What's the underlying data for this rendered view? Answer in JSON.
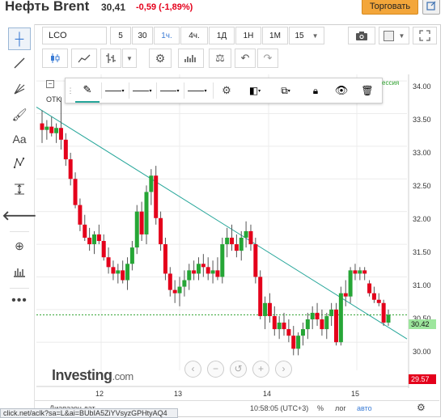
{
  "header": {
    "title": "Нефть Brent",
    "price": "30,41",
    "change": "-0,59 (-1,89%)",
    "trade_button": "Торговать"
  },
  "toolbar": {
    "symbol": "LCO",
    "intervals": [
      "5",
      "30",
      "1ч.",
      "4ч.",
      "1Д",
      "1Н",
      "1М",
      "15"
    ],
    "active_interval": "1ч."
  },
  "drawing_toolbar": {
    "items": [
      "pencil-icon",
      "line-style",
      "line-style",
      "line-style",
      "line-style",
      "gear-icon",
      "fill-icon",
      "copy-icon",
      "lock-icon",
      "eye-icon",
      "trash-icon"
    ]
  },
  "chart": {
    "session_label": "ессия",
    "legend_top": "",
    "legend_bottom": "OTK",
    "current_price_tag": "30.42",
    "low_price_tag": "29.57",
    "y_ticks": [
      "34.00",
      "33.50",
      "33.00",
      "32.50",
      "32.00",
      "31.50",
      "31.00",
      "30.50",
      "30.00"
    ],
    "x_ticks": [
      "12",
      "13",
      "14",
      "15"
    ]
  },
  "chart_data": {
    "type": "candlestick",
    "symbol": "LCO",
    "ylim": [
      29.57,
      34.1
    ],
    "y_ticks": [
      30.0,
      30.5,
      31.0,
      31.5,
      32.0,
      32.5,
      33.0,
      33.5,
      34.0
    ],
    "x_ticks": [
      "12",
      "13",
      "14",
      "15"
    ],
    "current_price": 30.42,
    "trendline": {
      "from": [
        0,
        33.6
      ],
      "to": [
        1,
        30.05
      ]
    },
    "candles": [
      {
        "o": 33.35,
        "h": 33.55,
        "l": 33.05,
        "c": 33.25
      },
      {
        "o": 33.25,
        "h": 33.4,
        "l": 33.1,
        "c": 33.3
      },
      {
        "o": 33.3,
        "h": 33.45,
        "l": 33.15,
        "c": 33.2
      },
      {
        "o": 33.2,
        "h": 33.35,
        "l": 33.05,
        "c": 33.28
      },
      {
        "o": 33.28,
        "h": 33.75,
        "l": 32.95,
        "c": 33.1
      },
      {
        "o": 33.1,
        "h": 33.2,
        "l": 32.7,
        "c": 32.8
      },
      {
        "o": 32.8,
        "h": 32.9,
        "l": 32.4,
        "c": 32.5
      },
      {
        "o": 32.5,
        "h": 32.6,
        "l": 32.05,
        "c": 32.1
      },
      {
        "o": 32.1,
        "h": 32.2,
        "l": 31.7,
        "c": 31.8
      },
      {
        "o": 31.8,
        "h": 31.95,
        "l": 31.55,
        "c": 31.6
      },
      {
        "o": 31.6,
        "h": 31.75,
        "l": 31.4,
        "c": 31.5
      },
      {
        "o": 31.5,
        "h": 31.7,
        "l": 31.35,
        "c": 31.65
      },
      {
        "o": 31.65,
        "h": 31.8,
        "l": 31.5,
        "c": 31.55
      },
      {
        "o": 31.55,
        "h": 31.65,
        "l": 31.25,
        "c": 31.3
      },
      {
        "o": 31.3,
        "h": 31.45,
        "l": 31.05,
        "c": 31.15
      },
      {
        "o": 31.15,
        "h": 31.25,
        "l": 30.95,
        "c": 31.05
      },
      {
        "o": 31.05,
        "h": 31.2,
        "l": 30.9,
        "c": 31.1
      },
      {
        "o": 31.1,
        "h": 31.25,
        "l": 30.9,
        "c": 30.95
      },
      {
        "o": 30.95,
        "h": 31.3,
        "l": 30.8,
        "c": 31.2
      },
      {
        "o": 31.2,
        "h": 31.55,
        "l": 31.1,
        "c": 31.45
      },
      {
        "o": 31.45,
        "h": 32.1,
        "l": 31.35,
        "c": 32.0
      },
      {
        "o": 32.0,
        "h": 32.15,
        "l": 31.55,
        "c": 31.65
      },
      {
        "o": 31.65,
        "h": 32.4,
        "l": 31.5,
        "c": 32.3
      },
      {
        "o": 32.3,
        "h": 32.65,
        "l": 32.1,
        "c": 32.55
      },
      {
        "o": 32.55,
        "h": 32.7,
        "l": 31.8,
        "c": 31.9
      },
      {
        "o": 31.9,
        "h": 32.0,
        "l": 31.4,
        "c": 31.5
      },
      {
        "o": 31.5,
        "h": 31.6,
        "l": 30.95,
        "c": 31.05
      },
      {
        "o": 31.05,
        "h": 31.15,
        "l": 30.7,
        "c": 30.8
      },
      {
        "o": 30.8,
        "h": 30.95,
        "l": 30.6,
        "c": 30.75
      },
      {
        "o": 30.75,
        "h": 31.0,
        "l": 30.55,
        "c": 30.85
      },
      {
        "o": 30.85,
        "h": 31.1,
        "l": 30.7,
        "c": 30.95
      },
      {
        "o": 30.95,
        "h": 31.2,
        "l": 30.8,
        "c": 31.1
      },
      {
        "o": 31.1,
        "h": 31.25,
        "l": 30.95,
        "c": 31.05
      },
      {
        "o": 31.05,
        "h": 31.3,
        "l": 30.95,
        "c": 31.2
      },
      {
        "o": 31.2,
        "h": 31.35,
        "l": 31.0,
        "c": 31.15
      },
      {
        "o": 31.15,
        "h": 31.3,
        "l": 30.95,
        "c": 31.05
      },
      {
        "o": 31.05,
        "h": 31.25,
        "l": 30.9,
        "c": 31.1
      },
      {
        "o": 31.1,
        "h": 31.3,
        "l": 30.95,
        "c": 31.0
      },
      {
        "o": 31.0,
        "h": 31.6,
        "l": 30.9,
        "c": 31.5
      },
      {
        "o": 31.5,
        "h": 31.75,
        "l": 31.3,
        "c": 31.6
      },
      {
        "o": 31.6,
        "h": 31.8,
        "l": 31.4,
        "c": 31.5
      },
      {
        "o": 31.5,
        "h": 31.65,
        "l": 31.3,
        "c": 31.4
      },
      {
        "o": 31.4,
        "h": 31.7,
        "l": 31.25,
        "c": 31.6
      },
      {
        "o": 31.6,
        "h": 31.85,
        "l": 31.45,
        "c": 31.7
      },
      {
        "o": 31.7,
        "h": 31.8,
        "l": 31.4,
        "c": 31.5
      },
      {
        "o": 31.5,
        "h": 31.6,
        "l": 30.9,
        "c": 31.0
      },
      {
        "o": 31.0,
        "h": 31.1,
        "l": 30.35,
        "c": 30.4
      },
      {
        "o": 30.4,
        "h": 30.7,
        "l": 30.2,
        "c": 30.6
      },
      {
        "o": 30.6,
        "h": 30.75,
        "l": 30.3,
        "c": 30.4
      },
      {
        "o": 30.4,
        "h": 30.55,
        "l": 30.1,
        "c": 30.2
      },
      {
        "o": 30.2,
        "h": 30.4,
        "l": 30.05,
        "c": 30.3
      },
      {
        "o": 30.3,
        "h": 30.45,
        "l": 30.1,
        "c": 30.2
      },
      {
        "o": 30.2,
        "h": 30.35,
        "l": 30.0,
        "c": 30.1
      },
      {
        "o": 30.1,
        "h": 30.25,
        "l": 29.8,
        "c": 29.9
      },
      {
        "o": 29.9,
        "h": 30.15,
        "l": 29.8,
        "c": 30.1
      },
      {
        "o": 30.1,
        "h": 30.3,
        "l": 29.95,
        "c": 30.2
      },
      {
        "o": 30.2,
        "h": 30.45,
        "l": 30.05,
        "c": 30.35
      },
      {
        "o": 30.35,
        "h": 30.55,
        "l": 30.2,
        "c": 30.45
      },
      {
        "o": 30.45,
        "h": 30.6,
        "l": 30.25,
        "c": 30.35
      },
      {
        "o": 30.35,
        "h": 30.5,
        "l": 30.1,
        "c": 30.2
      },
      {
        "o": 30.2,
        "h": 30.45,
        "l": 30.05,
        "c": 30.4
      },
      {
        "o": 30.4,
        "h": 30.6,
        "l": 30.25,
        "c": 30.5
      },
      {
        "o": 30.5,
        "h": 30.6,
        "l": 29.95,
        "c": 30.0
      },
      {
        "o": 30.0,
        "h": 30.85,
        "l": 29.95,
        "c": 30.75
      },
      {
        "o": 30.75,
        "h": 30.95,
        "l": 30.55,
        "c": 30.7
      },
      {
        "o": 30.7,
        "h": 31.15,
        "l": 30.6,
        "c": 31.1
      },
      {
        "o": 31.1,
        "h": 31.2,
        "l": 30.95,
        "c": 31.05
      },
      {
        "o": 31.05,
        "h": 31.15,
        "l": 30.95,
        "c": 31.1
      },
      {
        "o": 31.1,
        "h": 31.15,
        "l": 30.95,
        "c": 31.05
      },
      {
        "o": 30.9,
        "h": 30.95,
        "l": 30.7,
        "c": 30.75
      },
      {
        "o": 30.75,
        "h": 30.85,
        "l": 30.6,
        "c": 30.65
      },
      {
        "o": 30.65,
        "h": 30.75,
        "l": 30.55,
        "c": 30.6
      },
      {
        "o": 30.6,
        "h": 30.65,
        "l": 30.25,
        "c": 30.3
      },
      {
        "o": 30.3,
        "h": 30.5,
        "l": 30.25,
        "c": 30.42
      }
    ]
  },
  "bottom_bar": {
    "range_label": "Диапазон дат",
    "time": "10:58:05 (UTC+3)",
    "percent": "%",
    "log": "лог",
    "auto": "авто"
  },
  "brand": {
    "name": "Investing",
    "suffix": ".com"
  },
  "status_url": "click.net/aclk?sa=L&ai=BUbIA5ZiYVsyzGPHtyAQ4"
}
